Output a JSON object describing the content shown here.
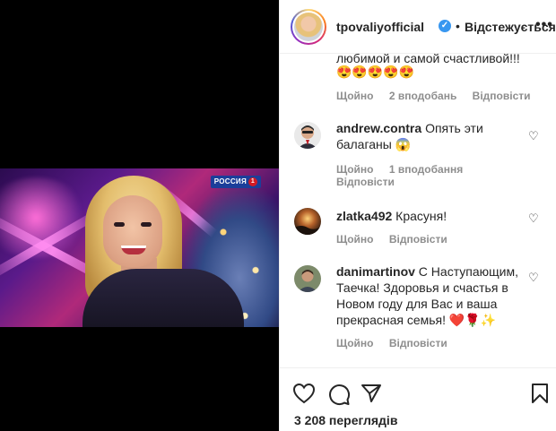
{
  "post": {
    "username": "tpovaliyofficial",
    "follow_status": "Відстежується",
    "views": "3 208 переглядів"
  },
  "video": {
    "channel_logo": "РОССИЯ",
    "channel_number": "1"
  },
  "comments": [
    {
      "partial_text": "любимой и самой счастливой!!!",
      "emoji": "😍😍😍😍😍",
      "time": "Щойно",
      "likes": "2 вподобань",
      "reply": "Відповісти"
    },
    {
      "username": "andrew.contra",
      "text": "Опять эти балаганы 😱",
      "time": "Щойно",
      "likes": "1 вподобання",
      "reply": "Відповісти"
    },
    {
      "username": "zlatka492",
      "text": "Красуня!",
      "time": "Щойно",
      "reply": "Відповісти"
    },
    {
      "username": "danimartinov",
      "text": "С Наступающим, Таечка! Здоровья и счастья в Новом году для Вас и ваша прекрасная семья! ❤️🌹✨",
      "time": "Щойно",
      "reply": "Відповісти"
    }
  ],
  "icons": {
    "more": "more-icon",
    "like": "heart-icon",
    "comment": "comment-icon",
    "share": "share-icon",
    "save": "bookmark-icon"
  },
  "colors": {
    "verified": "#3897f0",
    "secondary_text": "#8e8e8e",
    "border": "#efefef"
  }
}
